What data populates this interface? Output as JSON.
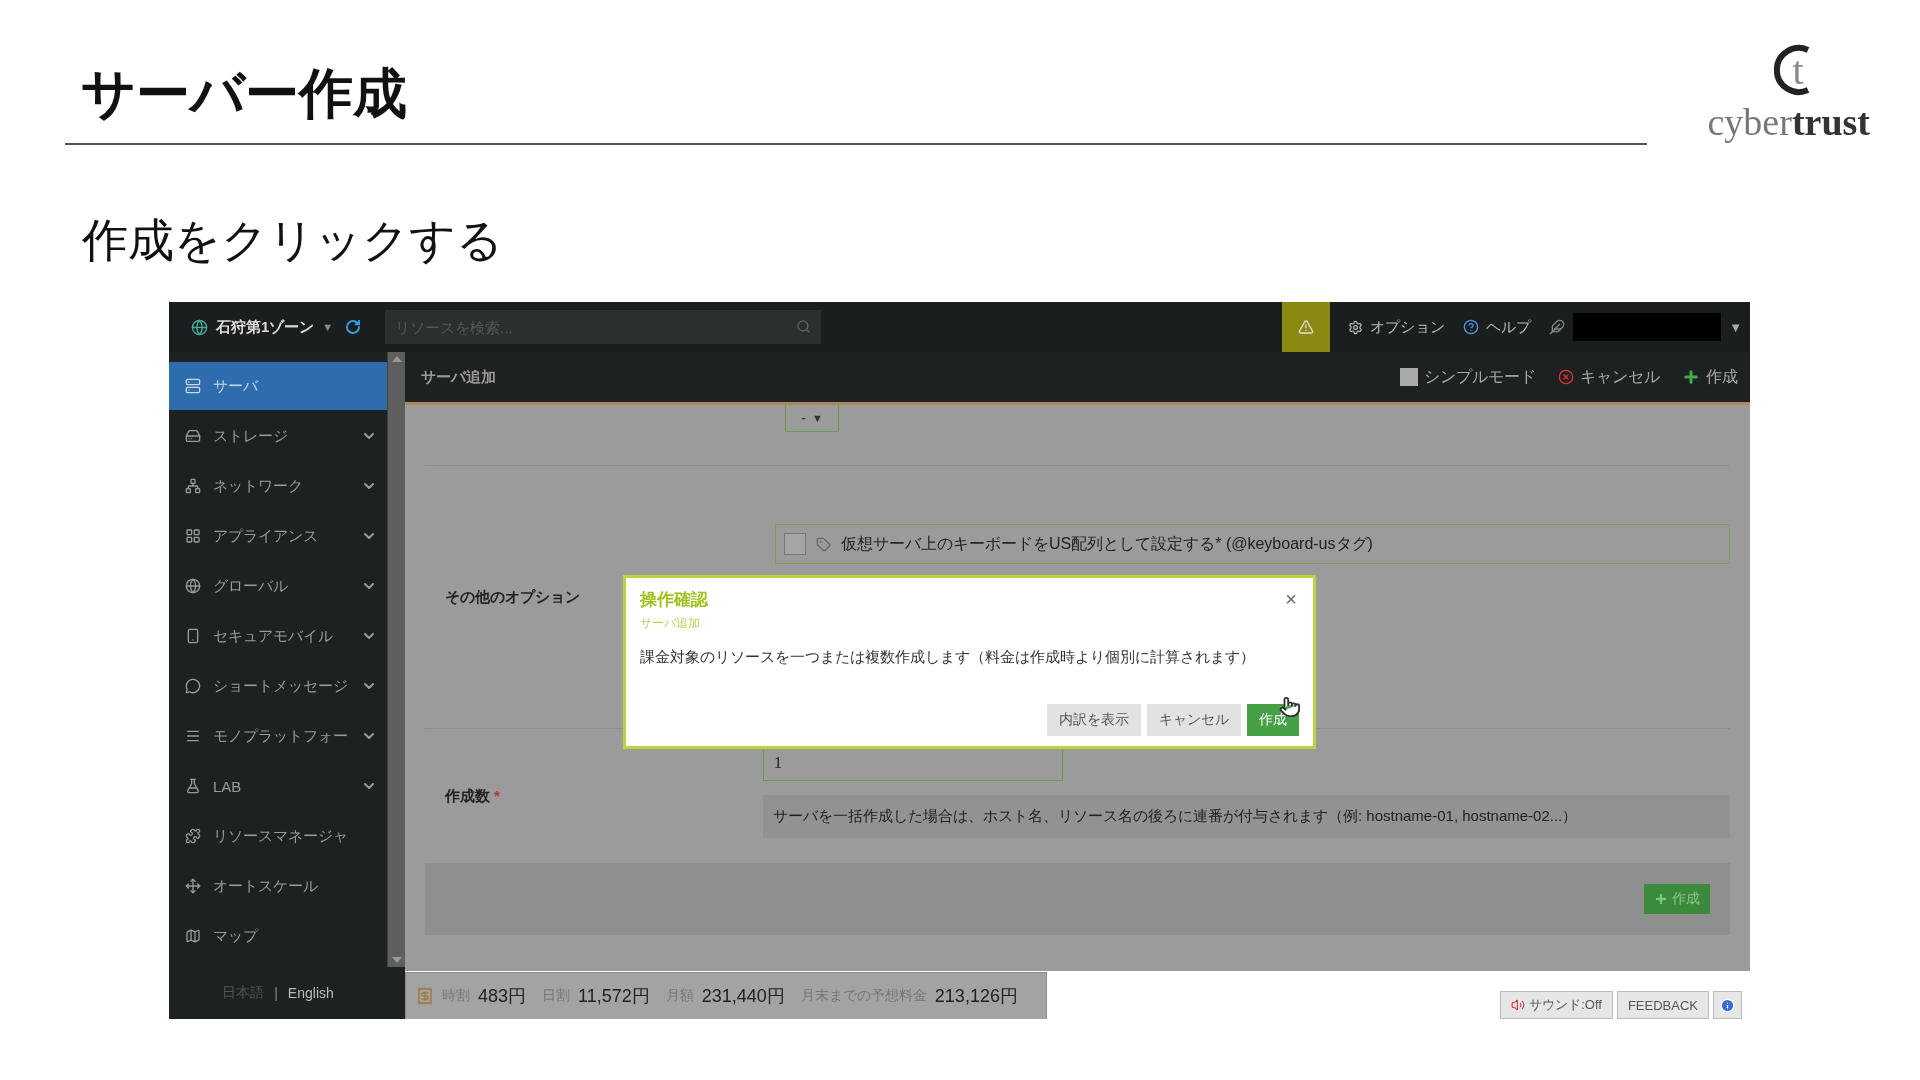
{
  "slide": {
    "title": "サーバー作成",
    "subtitle": "作成をクリックする",
    "logo": {
      "mark": "t",
      "word_light": "cyber",
      "word_bold": "trust"
    }
  },
  "topbar": {
    "zone": "石狩第1ゾーン",
    "zone_caret": "▼",
    "search": {
      "placeholder": "リソースを検索..."
    },
    "links": [
      "オプション",
      "ヘルプ"
    ],
    "user_caret": "▼"
  },
  "sidebar": {
    "items": [
      {
        "label": "サーバ",
        "selected": true,
        "expandable": false
      },
      {
        "label": "ストレージ",
        "selected": false,
        "expandable": true
      },
      {
        "label": "ネットワーク",
        "selected": false,
        "expandable": true
      },
      {
        "label": "アプライアンス",
        "selected": false,
        "expandable": true
      },
      {
        "label": "グローバル",
        "selected": false,
        "expandable": true
      },
      {
        "label": "セキュアモバイル",
        "selected": false,
        "expandable": true
      },
      {
        "label": "ショートメッセージ",
        "selected": false,
        "expandable": true
      },
      {
        "label": "モノプラットフォー",
        "selected": false,
        "expandable": true
      },
      {
        "label": "LAB",
        "selected": false,
        "expandable": true
      },
      {
        "label": "リソースマネージャ",
        "selected": false,
        "expandable": false
      },
      {
        "label": "オートスケール",
        "selected": false,
        "expandable": false
      },
      {
        "label": "マップ",
        "selected": false,
        "expandable": false
      }
    ],
    "languages": [
      {
        "label": "日本語",
        "selected": false
      },
      {
        "label": "English",
        "selected": true
      }
    ],
    "language_separator": "|"
  },
  "panel": {
    "title": "サーバ追加",
    "toolbar": [
      {
        "kind": "checkbox",
        "label": "シンプルモード",
        "checked": false
      },
      {
        "kind": "cancel",
        "label": "キャンセル"
      },
      {
        "kind": "create",
        "label": "作成"
      }
    ],
    "dropdown": {
      "value": "-",
      "caret": "▼"
    },
    "options": {
      "label": "その他のオプション",
      "items": [
        {
          "label": "仮想サーバ上のキーボードをUS配列として設定する* (@keyboard-usタグ)",
          "checked": false
        }
      ]
    },
    "count": {
      "label": "作成数",
      "required_mark": "*",
      "value": "1",
      "hint": "サーバを一括作成した場合は、ホスト名、リソース名の後ろに連番が付与されます（例: hostname-01, hostname-02...）"
    },
    "submit": "作成"
  },
  "dialog": {
    "title": "操作確認",
    "subtitle": "サーバ追加",
    "message": "課金対象のリソースを一つまたは複数作成します（料金は作成時より個別に計算されます）",
    "close": "×",
    "buttons": [
      {
        "label": "内訳を表示",
        "primary": false
      },
      {
        "label": "キャンセル",
        "primary": false
      },
      {
        "label": "作成",
        "primary": true
      }
    ]
  },
  "costs": [
    {
      "label": "時割",
      "value": "483円"
    },
    {
      "label": "日割",
      "value": "11,572円"
    },
    {
      "label": "月額",
      "value": "231,440円"
    },
    {
      "label": "月末までの予想料金",
      "value": "213,126円"
    }
  ],
  "footer_buttons": [
    {
      "kind": "sound",
      "label": "サウンド:Off"
    },
    {
      "kind": "feedback",
      "label": "FEEDBACK"
    },
    {
      "kind": "info"
    }
  ]
}
